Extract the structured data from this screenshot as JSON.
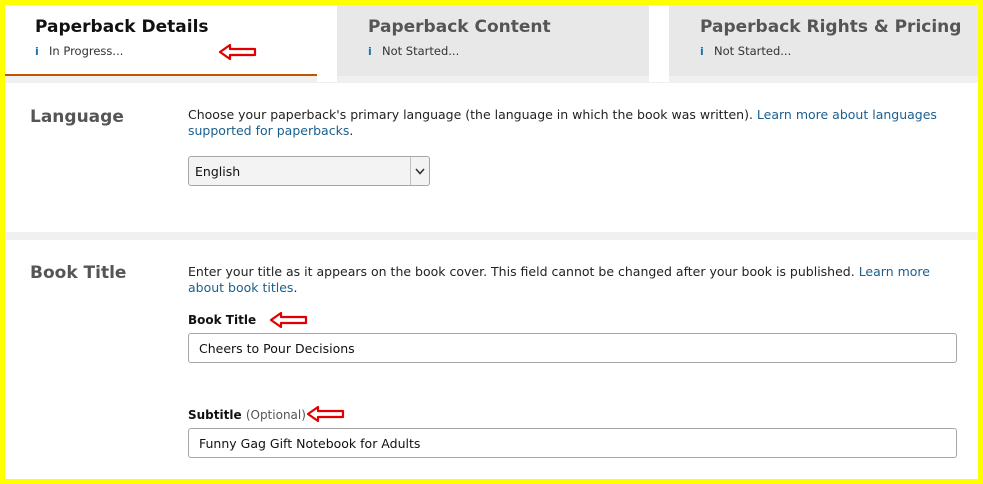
{
  "tabs": [
    {
      "title": "Paperback Details",
      "status": "In Progress...",
      "info_icon": "i"
    },
    {
      "title": "Paperback Content",
      "status": "Not Started...",
      "info_icon": "i"
    },
    {
      "title": "Paperback Rights & Pricing",
      "status": "Not Started...",
      "info_icon": "i"
    }
  ],
  "language": {
    "section_label": "Language",
    "description": "Choose your paperback's primary language (the language in which the book was written). ",
    "link": "Learn more about languages supported for paperbacks",
    "link_suffix": ".",
    "selected": "English",
    "chevron": "⌄"
  },
  "book_title": {
    "section_label": "Book Title",
    "description": "Enter your title as it appears on the book cover. This field cannot be changed after your book is published. ",
    "link": "Learn more about book titles",
    "link_suffix": ".",
    "title_label": "Book Title",
    "title_value": "Cheers to Pour Decisions",
    "subtitle_label": "Subtitle",
    "subtitle_optional": "(Optional)",
    "subtitle_value": "Funny Gag Gift Notebook for Adults"
  },
  "colors": {
    "highlight_border": "#ffff00",
    "active_tab_underline": "#c45500",
    "annotation_arrow": "#e00000",
    "link": "#1a5f8f"
  }
}
